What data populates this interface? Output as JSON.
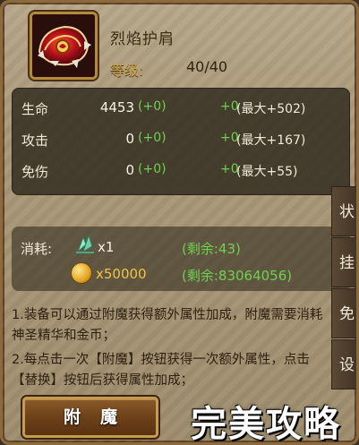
{
  "item": {
    "name": "烈焰护肩",
    "level_label": "等级:",
    "level_value": "40/40"
  },
  "stats": [
    {
      "name": "生命",
      "value": "4453",
      "bonus": "(+0)",
      "plus": "+0",
      "max": "(最大+502)"
    },
    {
      "name": "攻击",
      "value": "0",
      "bonus": "(+0)",
      "plus": "+0",
      "max": "(最大+167)"
    },
    {
      "name": "免伤",
      "value": "0",
      "bonus": "(+0)",
      "plus": "+0",
      "max": "(最大+55)"
    }
  ],
  "cost": {
    "label": "消耗:",
    "essence_icon": "holy-essence-icon",
    "essence_qty": "x1",
    "essence_remaining": "(剩余:43)",
    "gold_icon": "gold-coin-icon",
    "gold_qty": "x50000",
    "gold_remaining": "(剩余:83064056)"
  },
  "description": {
    "line1": "1.装备可以通过附魔获得额外属性加成，附魔需要消耗神圣精华和金币；",
    "line2": "2.每点击一次【附魔】按钮获得一次额外属性，点击【替换】按钮后获得属性加成；"
  },
  "side_tabs": [
    "状",
    "挂",
    "免",
    "设"
  ],
  "buttons": {
    "enchant": "附魔"
  },
  "watermark": "完美攻略",
  "colors": {
    "green": "#6ed14e",
    "gold": "#c9a04a",
    "panel": "#2a2216"
  }
}
